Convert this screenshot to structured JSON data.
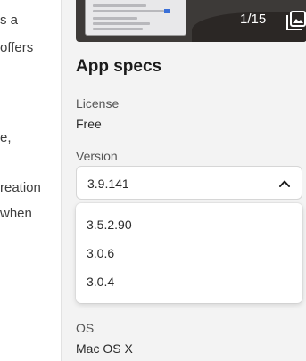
{
  "article": {
    "fragments": [
      "s a",
      "offers",
      "e,",
      "reation",
      "when"
    ]
  },
  "gallery": {
    "counter": "1/15",
    "icon": "image-gallery-icon"
  },
  "specs": {
    "title": "App specs",
    "license_label": "License",
    "license_value": "Free",
    "version_label": "Version",
    "version_selected": "3.9.141",
    "version_options": [
      "3.5.2.90",
      "3.0.6",
      "3.0.4"
    ],
    "os_label": "OS",
    "os_value": "Mac OS X"
  },
  "colors": {
    "panel_bg": "#f3f3f3",
    "text_dark": "#1b1b1b",
    "text_muted": "#555555"
  }
}
